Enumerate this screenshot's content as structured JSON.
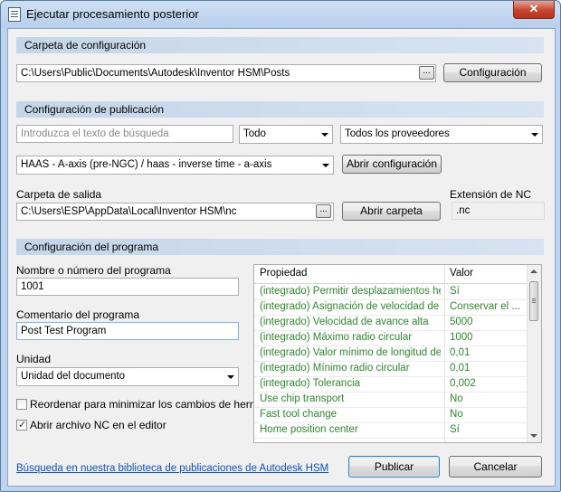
{
  "window": {
    "title": "Ejecutar procesamiento posterior",
    "close_label": "✕"
  },
  "config_folder": {
    "section_title": "Carpeta de configuración",
    "path": "C:\\Users\\Public\\Documents\\Autodesk\\Inventor HSM\\Posts",
    "browse_label": "...",
    "config_button": "Configuración"
  },
  "publish_config": {
    "section_title": "Configuración de publicación",
    "search_placeholder": "Introduzca el texto de búsqueda",
    "filter_value": "Todo",
    "vendor_value": "Todos los proveedores",
    "post_value": "HAAS - A-axis (pre-NGC) / haas - inverse time - a-axis",
    "open_config_button": "Abrir configuración",
    "output_folder_label": "Carpeta de salida",
    "output_folder_path": "C:\\Users\\ESP\\AppData\\Local\\Inventor HSM\\nc",
    "output_browse_label": "...",
    "open_folder_button": "Abrir carpeta",
    "nc_extension_label": "Extensión de NC",
    "nc_extension_value": ".nc"
  },
  "program_config": {
    "section_title": "Configuración del programa",
    "program_name_label": "Nombre o número del programa",
    "program_name_value": "1001",
    "comment_label": "Comentario del programa",
    "comment_value": "Post Test Program",
    "unit_label": "Unidad",
    "unit_value": "Unidad del documento",
    "reorder_label": "Reordenar para minimizar los cambios de herrami",
    "reorder_checked": false,
    "open_nc_label": "Abrir archivo NC en el editor",
    "open_nc_checked": true,
    "check_glyph": "✓"
  },
  "properties": {
    "headers": [
      "Propiedad",
      "Valor"
    ],
    "rows": [
      {
        "property": "(integrado) Permitir desplazamientos he...",
        "value": "Sí"
      },
      {
        "property": "(integrado) Asignación de velocidad de ...",
        "value": "Conservar el ..."
      },
      {
        "property": "(integrado) Velocidad de avance alta",
        "value": "5000"
      },
      {
        "property": "(integrado) Máximo radio circular",
        "value": "1000"
      },
      {
        "property": "(integrado) Valor mínimo de longitud de ...",
        "value": "0,01"
      },
      {
        "property": "(integrado) Mínimo radio circular",
        "value": "0,01"
      },
      {
        "property": "(integrado) Tolerancia",
        "value": "0,002"
      },
      {
        "property": "Use chip transport",
        "value": "No"
      },
      {
        "property": "Fast tool change",
        "value": "No"
      },
      {
        "property": "Home position center",
        "value": "Sí"
      }
    ],
    "builtin_color": "#2e8b2e"
  },
  "footer": {
    "library_link": "Búsqueda en nuestra biblioteca de publicaciones de Autodesk HSM",
    "publish_button": "Publicar",
    "cancel_button": "Cancelar"
  }
}
